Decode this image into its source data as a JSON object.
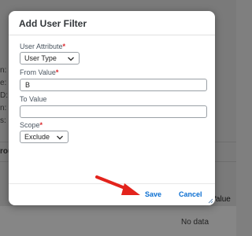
{
  "dialog": {
    "title": "Add User Filter",
    "fields": {
      "attribute": {
        "label": "User Attribute",
        "value": "User Type"
      },
      "from_value": {
        "label": "From Value",
        "value": "B"
      },
      "to_value": {
        "label": "To Value",
        "value": ""
      },
      "scope": {
        "label": "Scope",
        "value": "Exclude"
      }
    },
    "required_mark": "*",
    "save_label": "Save",
    "cancel_label": "Cancel"
  },
  "background": {
    "labels": [
      "n:",
      "e:",
      "D:",
      "n:",
      "s:"
    ],
    "group_label": "rou",
    "value_column": "Value",
    "no_data": "No data"
  },
  "colors": {
    "accent": "#0a6ed1",
    "required": "#d9262b",
    "arrow": "#e3231c"
  }
}
